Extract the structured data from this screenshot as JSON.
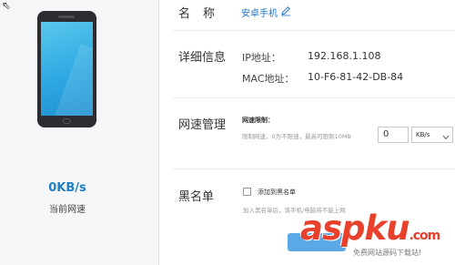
{
  "left_panel": {
    "speed_value": "0KB/s",
    "speed_label": "当前网速"
  },
  "rows": {
    "name_label": "名称",
    "detail_label": "详细信息",
    "speed_label": "网速管理",
    "blacklist_label": "黑名单"
  },
  "device": {
    "name": "安卓手机"
  },
  "details": {
    "ip_key": "IP地址：",
    "ip_value": "192.168.1.108",
    "mac_key": "MAC地址：",
    "mac_value": "10-F6-81-42-DB-84"
  },
  "speed_limit": {
    "title": "网速限制：",
    "hint": "限制网速，0为不限速，最高可限制10MB",
    "value": "0",
    "unit": "KB/s"
  },
  "blacklist": {
    "checkbox_label": "添加到黑名单",
    "hint": "加入黑名单后，该手机/电脑将不能上网"
  },
  "watermark": {
    "brand": "aspku",
    "suffix": ".com",
    "subtitle": "免费网站源码下载站!"
  },
  "colors": {
    "accent": "#1f77c7",
    "watermark": "#e8402a",
    "button": "#5aa9e6"
  }
}
